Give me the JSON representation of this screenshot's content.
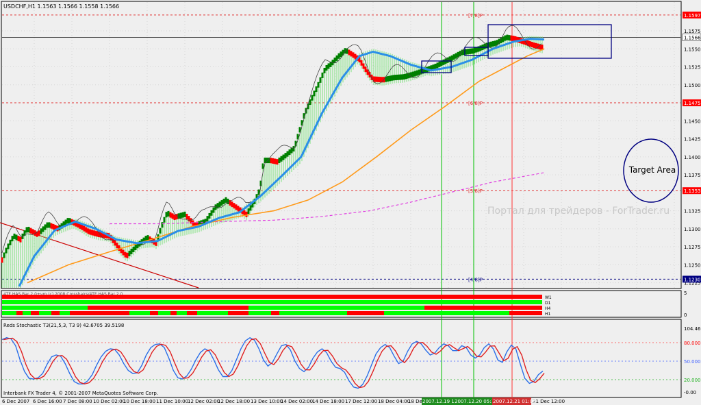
{
  "chart_data": {
    "type": "candlestick",
    "title": "USDCHF,H1  1.1563 1.1566 1.1558 1.1566",
    "watermark": "Портал для трейдеров - ForTrader.ru",
    "annotation_box": "Target Area",
    "price_axis": {
      "ylim": [
        1.1218,
        1.1615
      ],
      "ticks": [
        "1.1575",
        "1.1550",
        "1.1525",
        "1.1500",
        "1.1450",
        "1.1425",
        "1.1400",
        "1.1375",
        "1.1325",
        "1.1300",
        "1.1275",
        "1.1250",
        "1.1225"
      ],
      "tick_values": [
        1.1575,
        1.155,
        1.1525,
        1.15,
        1.145,
        1.1425,
        1.14,
        1.1375,
        1.1325,
        1.13,
        1.1275,
        1.125,
        1.1225
      ],
      "current_price": "1.1566",
      "current_value": 1.1566,
      "level_tags": [
        {
          "text": "1.1597",
          "value": 1.1597,
          "color": "#ff0000"
        },
        {
          "text": "1.1475",
          "value": 1.1475,
          "color": "#ff0000"
        },
        {
          "text": "1.1353",
          "value": 1.1353,
          "color": "#ff0000"
        },
        {
          "text": "1.1230",
          "value": 1.123,
          "color": "#000080"
        }
      ]
    },
    "murrey_levels": [
      {
        "label": "[7/8]P",
        "value": 1.1597
      },
      {
        "label": "[6/8]P",
        "value": 1.1475
      },
      {
        "label": "[5/8]P",
        "value": 1.1353
      },
      {
        "label": "[4/8]P",
        "value": 1.123
      }
    ],
    "signal_panel": {
      "header": "4TF HAS Bar 2.0+vm (c) 2008 Crosshairs/4TF HAS Bar 2.0",
      "rows": [
        "W1",
        "D1",
        "H4",
        "H1"
      ],
      "scale": [
        "5",
        "0"
      ]
    },
    "stochastic": {
      "title": "Reds Stochastic T3(21,5,3, T3 9)  42.6705  39.5198",
      "ticks": [
        "104.46",
        "80.0000",
        "50.0000",
        "20.0000",
        "-0.00"
      ],
      "tick_values": [
        104.46,
        80,
        50,
        20,
        0
      ],
      "levels": [
        80,
        50,
        20
      ],
      "k": [
        85,
        88,
        86,
        75,
        52,
        33,
        22,
        21,
        23,
        30,
        45,
        57,
        60,
        58,
        46,
        30,
        17,
        13,
        13,
        18,
        28,
        44,
        57,
        66,
        70,
        69,
        60,
        46,
        35,
        30,
        31,
        43,
        60,
        72,
        77,
        78,
        72,
        55,
        35,
        23,
        21,
        26,
        37,
        52,
        64,
        70,
        66,
        52,
        36,
        25,
        25,
        35,
        52,
        70,
        83,
        88,
        84,
        70,
        52,
        42,
        48,
        62,
        75,
        77,
        68,
        50,
        38,
        33,
        40,
        55,
        65,
        70,
        64,
        50,
        40,
        38,
        32,
        18,
        8,
        6,
        12,
        26,
        44,
        62,
        72,
        77,
        72,
        58,
        46,
        50,
        66,
        78,
        82,
        78,
        68,
        60,
        63,
        72,
        78,
        75,
        67,
        67,
        75,
        72,
        60,
        55,
        60,
        72,
        78,
        70,
        52,
        48,
        65,
        76,
        70,
        45,
        22,
        14,
        17,
        28,
        34
      ]
    },
    "footer_text": "Interbank FX Trader 4, © 2001-2007 MetaQuotes Software Corp.",
    "time_axis": {
      "labels": [
        "6 Dec 2007",
        "6 Dec 16:00",
        "7 Dec 08:00",
        "10 Dec 02:00",
        "10 Dec 18:00",
        "11 Dec 10:00",
        "12 Dec 02:00",
        "12 Dec 18:00",
        "13 Dec 10:00",
        "14 Dec 02:00",
        "14 Dec 18:00",
        "17 Dec 12:00",
        "18 Dec 04:00",
        "18 Dec",
        "19 Dec 12:00",
        "20 Dec 04:00",
        "20 Dec 20:00",
        "21 Dec 12:00"
      ],
      "highlights": [
        {
          "text": "2007.12.19 13:00",
          "color": "#1e8c1e"
        },
        {
          "text": "2007.12.20 05:15",
          "color": "#1e8c1e"
        },
        {
          "text": "2007.12.21 01:00",
          "color": "#d03030"
        }
      ]
    },
    "price_path": [
      [
        0,
        1.125
      ],
      [
        10,
        1.1272
      ],
      [
        20,
        1.129
      ],
      [
        30,
        1.1285
      ],
      [
        40,
        1.13
      ],
      [
        55,
        1.1292
      ],
      [
        70,
        1.1306
      ],
      [
        85,
        1.13
      ],
      [
        100,
        1.1312
      ],
      [
        115,
        1.1305
      ],
      [
        130,
        1.1296
      ],
      [
        145,
        1.1292
      ],
      [
        160,
        1.129
      ],
      [
        175,
        1.1272
      ],
      [
        185,
        1.1262
      ],
      [
        200,
        1.1276
      ],
      [
        215,
        1.1288
      ],
      [
        228,
        1.128
      ],
      [
        236,
        1.1303
      ],
      [
        244,
        1.1322
      ],
      [
        255,
        1.1316
      ],
      [
        270,
        1.132
      ],
      [
        285,
        1.1305
      ],
      [
        300,
        1.131
      ],
      [
        315,
        1.133
      ],
      [
        330,
        1.134
      ],
      [
        345,
        1.133
      ],
      [
        360,
        1.132
      ],
      [
        372,
        1.1338
      ],
      [
        380,
        1.1355
      ],
      [
        385,
        1.1395
      ],
      [
        395,
        1.1395
      ],
      [
        405,
        1.1393
      ],
      [
        415,
        1.14
      ],
      [
        430,
        1.1412
      ],
      [
        445,
        1.146
      ],
      [
        455,
        1.148
      ],
      [
        465,
        1.15
      ],
      [
        475,
        1.1522
      ],
      [
        485,
        1.153
      ],
      [
        495,
        1.154
      ],
      [
        505,
        1.1548
      ],
      [
        515,
        1.1542
      ],
      [
        525,
        1.1535
      ],
      [
        535,
        1.152
      ],
      [
        545,
        1.1508
      ],
      [
        560,
        1.1507
      ],
      [
        575,
        1.151
      ],
      [
        590,
        1.1511
      ],
      [
        605,
        1.1515
      ],
      [
        620,
        1.152
      ],
      [
        635,
        1.1525
      ],
      [
        645,
        1.153
      ],
      [
        660,
        1.1537
      ],
      [
        675,
        1.1545
      ],
      [
        690,
        1.1547
      ],
      [
        700,
        1.155
      ],
      [
        712,
        1.1555
      ],
      [
        725,
        1.1558
      ],
      [
        740,
        1.1566
      ],
      [
        752,
        1.1564
      ],
      [
        765,
        1.156
      ],
      [
        780,
        1.1555
      ],
      [
        792,
        1.1552
      ]
    ],
    "ma_blue": [
      [
        28,
        1.122
      ],
      [
        50,
        1.1262
      ],
      [
        80,
        1.1298
      ],
      [
        110,
        1.131
      ],
      [
        140,
        1.13
      ],
      [
        170,
        1.1285
      ],
      [
        200,
        1.128
      ],
      [
        230,
        1.1283
      ],
      [
        260,
        1.1297
      ],
      [
        290,
        1.1303
      ],
      [
        320,
        1.1315
      ],
      [
        350,
        1.1323
      ],
      [
        380,
        1.1345
      ],
      [
        410,
        1.1372
      ],
      [
        440,
        1.14
      ],
      [
        470,
        1.146
      ],
      [
        500,
        1.151
      ],
      [
        525,
        1.154
      ],
      [
        545,
        1.1546
      ],
      [
        570,
        1.154
      ],
      [
        600,
        1.1528
      ],
      [
        630,
        1.152
      ],
      [
        660,
        1.1525
      ],
      [
        690,
        1.1535
      ],
      [
        720,
        1.155
      ],
      [
        750,
        1.156
      ],
      [
        775,
        1.1564
      ],
      [
        795,
        1.1563
      ]
    ],
    "ma_orange": [
      [
        40,
        1.1225
      ],
      [
        100,
        1.125
      ],
      [
        160,
        1.1268
      ],
      [
        220,
        1.1285
      ],
      [
        280,
        1.1303
      ],
      [
        340,
        1.1316
      ],
      [
        400,
        1.1325
      ],
      [
        450,
        1.134
      ],
      [
        500,
        1.1365
      ],
      [
        550,
        1.14
      ],
      [
        600,
        1.1437
      ],
      [
        650,
        1.147
      ],
      [
        700,
        1.1505
      ],
      [
        740,
        1.1525
      ],
      [
        770,
        1.154
      ],
      [
        795,
        1.155
      ]
    ],
    "ma_magenta": [
      [
        160,
        1.1307
      ],
      [
        240,
        1.1307
      ],
      [
        320,
        1.131
      ],
      [
        400,
        1.1312
      ],
      [
        470,
        1.1317
      ],
      [
        540,
        1.1325
      ],
      [
        600,
        1.1337
      ],
      [
        660,
        1.1351
      ],
      [
        720,
        1.1365
      ],
      [
        795,
        1.1378
      ]
    ],
    "vertical_markers": [
      {
        "x": 645,
        "color": "#00c000"
      },
      {
        "x": 692,
        "color": "#00c000"
      },
      {
        "x": 748,
        "color": "#ff3030"
      }
    ]
  }
}
